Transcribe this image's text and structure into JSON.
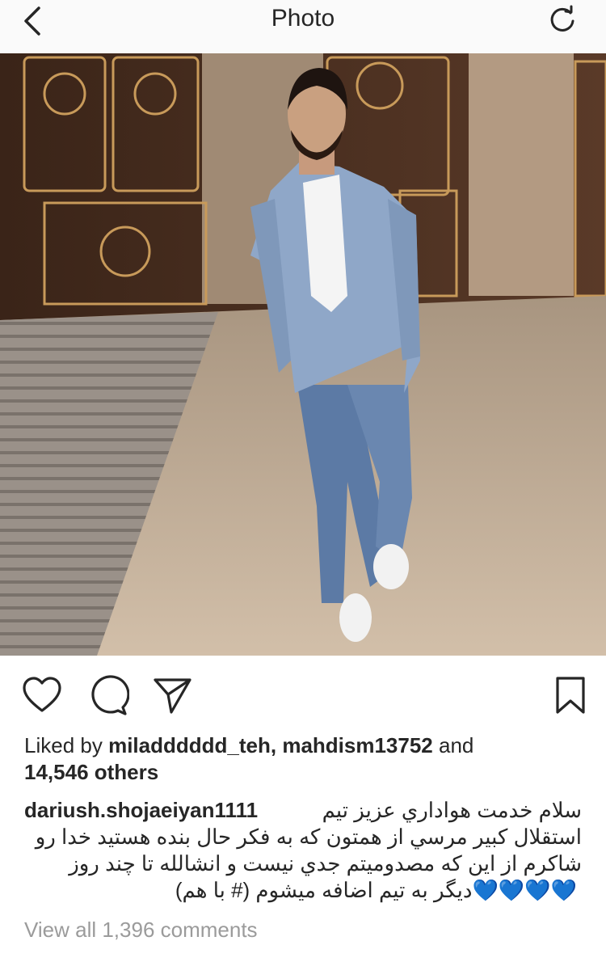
{
  "header": {
    "title": "Photo",
    "back_icon": "chevron-left-icon",
    "refresh_icon": "refresh-icon"
  },
  "photo": {
    "description_icon": "post-photo"
  },
  "actions": {
    "like_icon": "heart-icon",
    "comment_icon": "comment-icon",
    "share_icon": "send-icon",
    "save_icon": "bookmark-icon"
  },
  "likes": {
    "prefix": "Liked by",
    "user1": "miladddddd_teh",
    "separator": ",",
    "user2": "mahdism13752",
    "and": "and",
    "count": "14,546 others"
  },
  "caption": {
    "username": "dariush.shojaeiyan1111",
    "line1": "سلام خدمت هواداري عزيز تيم",
    "line2": "استقلال كبير مرسي از همتون كه به فكر حال بنده هستيد خدا رو",
    "line3": "شاكرم از اين كه مصدوميتم جدي نيست و انشالله تا چند روز",
    "line4": "ديگر به تيم اضافه ميشوم (# با هم)",
    "hearts": "💙💙💙💙"
  },
  "comments": {
    "view_all": "View all 1,396 comments"
  },
  "colors": {
    "text": "#262626",
    "muted": "#9b9b9b",
    "heart_blue": "#1d8fe8",
    "topbar_bg": "#fafafa"
  }
}
